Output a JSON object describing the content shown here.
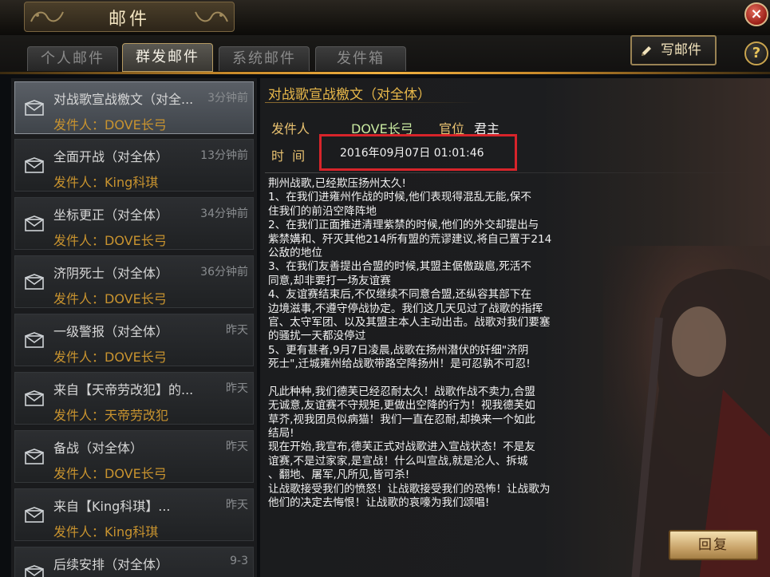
{
  "window": {
    "title": "邮件",
    "close_symbol": "×",
    "help_symbol": "?"
  },
  "tabs": [
    {
      "label": "个人邮件"
    },
    {
      "label": "群发邮件"
    },
    {
      "label": "系统邮件"
    },
    {
      "label": "发件箱"
    }
  ],
  "toolbar": {
    "write_label": "写邮件",
    "write_icon": "pencil-icon"
  },
  "mail_list": [
    {
      "subject": "对战歌宣战檄文（对全...",
      "time": "3分钟前",
      "sender": "发件人：DOVE长弓"
    },
    {
      "subject": "全面开战（对全体）",
      "time": "13分钟前",
      "sender": "发件人：King科琪"
    },
    {
      "subject": "坐标更正（对全体）",
      "time": "34分钟前",
      "sender": "发件人：DOVE长弓"
    },
    {
      "subject": "济阴死士（对全体）",
      "time": "36分钟前",
      "sender": "发件人：DOVE长弓"
    },
    {
      "subject": "一级警报（对全体）",
      "time": "昨天",
      "sender": "发件人：DOVE长弓"
    },
    {
      "subject": "来自【天帝劳改犯】的...",
      "time": "昨天",
      "sender": "发件人：天帝劳改犯"
    },
    {
      "subject": "备战（对全体）",
      "time": "昨天",
      "sender": "发件人：DOVE长弓"
    },
    {
      "subject": "来自【King科琪】...",
      "time": "昨天",
      "sender": "发件人：King科琪"
    },
    {
      "subject": "后续安排（对全体）",
      "time": "9-3",
      "sender": ""
    }
  ],
  "detail": {
    "title": "对战歌宣战檄文（对全体）",
    "sender_label": "发件人",
    "sender_value": "DOVE长弓",
    "rank_label": "官位",
    "rank_value": "君主",
    "time_label": "时  间",
    "time_value": "2016年09月07日 01:01:46",
    "body_lines": [
      "荆州战歌,已经欺压扬州太久!",
      "1、在我们进雍州作战的时候,他们表现得混乱无能,保不",
      "住我们的前沿空降阵地",
      "2、在我们正面推进清理紫禁的时候,他们的外交却提出与",
      "紫禁媾和、歼灭其他214所有盟的荒谬建议,将自己置于214",
      "公敌的地位",
      "3、在我们友善提出合盟的时候,其盟主倨傲跋扈,死活不",
      "同意,却非要打一场友谊赛",
      "4、友谊赛结束后,不仅继续不同意合盟,还纵容其部下在",
      "边境滋事,不遵守停战协定。我们这几天见过了战歌的指挥",
      "官、太守军团、以及其盟主本人主动出击。战歌对我们要塞",
      "的骚扰一天都没停过",
      "5、更有甚者,9月7日凌晨,战歌在扬州潜伏的奸细\"济阴",
      "死士\",迁城雍州给战歌带路空降扬州！是可忍孰不可忍!",
      "",
      "凡此种种,我们德芙已经忍耐太久！战歌作战不卖力,合盟",
      "无诚意,友谊赛不守规矩,更做出空降的行为！视我德芙如",
      "草芥,视我团员似病猫！我们一直在忍耐,却换来一个如此",
      "结局!",
      "现在开始,我宣布,德芙正式对战歌进入宣战状态！不是友",
      "谊赛,不是过家家,是宣战！什么叫宣战,就是沦人、拆城",
      "、翻地、屠军,凡所见,皆可杀!",
      "让战歌接受我们的愤怒！让战歌接受我们的恐怖！让战歌为",
      "他们的决定去悔恨！让战歌的哀嚎为我们颂唱!"
    ],
    "reply_label": "回复"
  }
}
